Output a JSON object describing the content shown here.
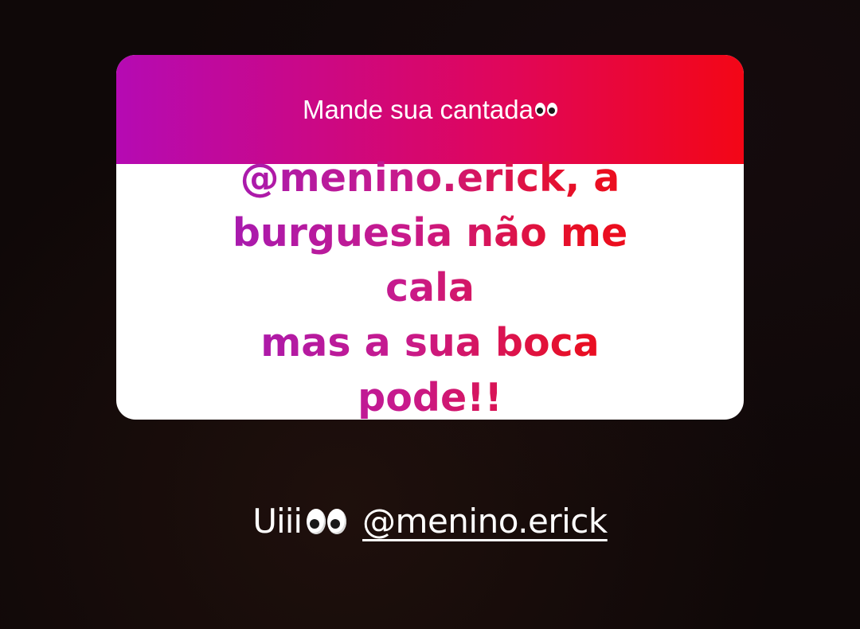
{
  "question_sticker": {
    "title": "Mande sua cantada",
    "title_emoji": "eyes-emoji",
    "answer_line_1": "@menino.erick, a",
    "answer_line_2": "burguesia não me cala",
    "answer_line_3": "mas a sua boca pode!!",
    "header_gradient": [
      "#b50ab3",
      "#e0065a",
      "#f30616"
    ],
    "answer_gradient": [
      "#9f1ab8",
      "#c81a8c",
      "#e80f25",
      "#f10b14"
    ]
  },
  "caption": {
    "text": "Uiii",
    "emoji": "eyes-emoji",
    "mention": "@menino.erick"
  },
  "background_color": "#0f0808"
}
